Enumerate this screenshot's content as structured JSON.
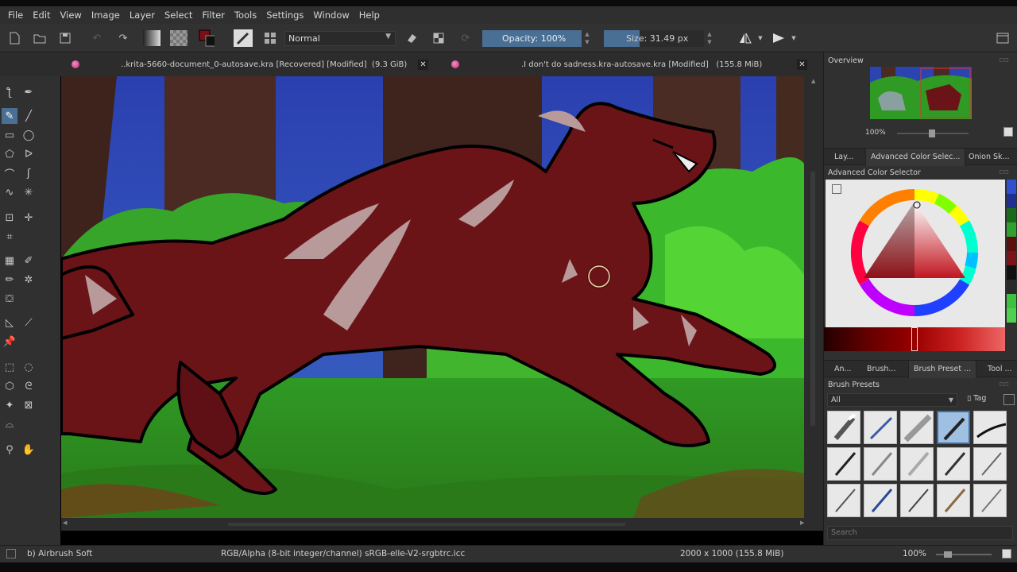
{
  "menu": [
    "File",
    "Edit",
    "View",
    "Image",
    "Layer",
    "Select",
    "Filter",
    "Tools",
    "Settings",
    "Window",
    "Help"
  ],
  "toolbar": {
    "blend_mode": "Normal",
    "opacity_label": "Opacity:",
    "opacity_value": "100%",
    "size_label": "Size:",
    "size_value": "31.49 px",
    "size_fraction": 0.36
  },
  "documents": [
    {
      "title": "..krita-5660-document_0-autosave.kra [Recovered]",
      "state": "[Modified]",
      "size": "(9.3 GiB)"
    },
    {
      "title": ".I don't do sadness.kra-autosave.kra",
      "state": "[Modified]",
      "size": "(155.8 MiB)"
    }
  ],
  "dock": {
    "overview_title": "Overview",
    "overview_zoom": "100%",
    "top_tabs": [
      "Lay...",
      "Advanced Color Selec...",
      "Onion Sk..."
    ],
    "color_selector_title": "Advanced Color Selector",
    "bottom_tabs": [
      "An...",
      "Brush...",
      "Brush Preset ...",
      "Tool ..."
    ],
    "presets_title": "Brush Presets",
    "presets_filter": "All",
    "presets_tag": "Tag",
    "search_placeholder": "Search"
  },
  "status": {
    "brush": "b) Airbrush Soft",
    "color_space": "RGB/Alpha (8-bit integer/channel)  sRGB-elle-V2-srgbtrc.icc",
    "image_size": "2000 x 1000 (155.8 MiB)",
    "zoom": "100%"
  },
  "colors": {
    "accent": "#4a6f94",
    "wolf_body": "#6b1418",
    "wolf_highlight": "#b89a9a",
    "foliage": "#3fae2a",
    "sky": "#2a4aa8",
    "trunk": "#4a2a22"
  },
  "icons": {
    "new": "new-document-icon",
    "open": "open-folder-icon",
    "save": "save-icon",
    "undo": "undo-icon",
    "redo": "redo-icon",
    "eraser": "eraser-icon",
    "alpha_lock": "alpha-lock-icon",
    "reload": "reload-icon",
    "mirror_h": "mirror-horizontal-icon",
    "mirror_v": "mirror-vertical-icon",
    "workspace": "workspace-icon"
  }
}
